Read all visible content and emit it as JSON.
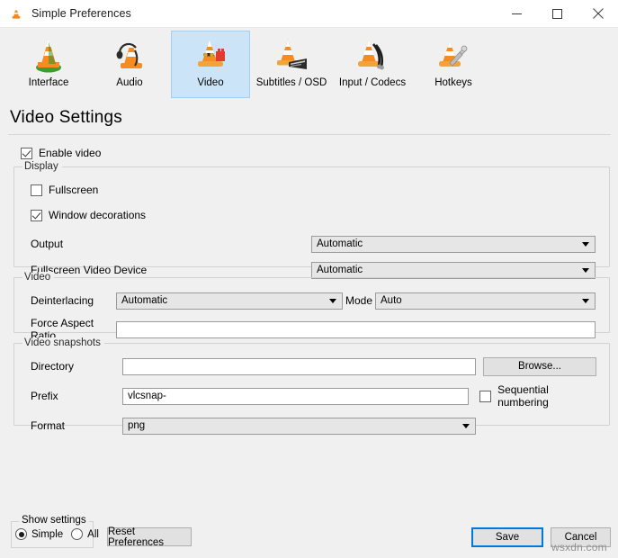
{
  "window": {
    "title": "Simple Preferences",
    "icon": "vlc-cone-icon",
    "minimize_label": "–",
    "maximize_label": "□",
    "close_label": "✕"
  },
  "toolbar": {
    "items": [
      {
        "label": "Interface",
        "icon": "vlc-cone-interface-icon",
        "selected": false
      },
      {
        "label": "Audio",
        "icon": "vlc-cone-headphones-icon",
        "selected": false
      },
      {
        "label": "Video",
        "icon": "vlc-cone-video-icon",
        "selected": true
      },
      {
        "label": "Subtitles / OSD",
        "icon": "vlc-cone-subtitles-icon",
        "selected": false
      },
      {
        "label": "Input / Codecs",
        "icon": "vlc-cone-input-icon",
        "selected": false
      },
      {
        "label": "Hotkeys",
        "icon": "vlc-cone-hotkeys-icon",
        "selected": false
      }
    ]
  },
  "page": {
    "heading": "Video Settings",
    "enable_video": {
      "label": "Enable video",
      "checked": true
    }
  },
  "display": {
    "title": "Display",
    "fullscreen": {
      "label": "Fullscreen",
      "checked": false
    },
    "window_decorations": {
      "label": "Window decorations",
      "checked": true
    },
    "output": {
      "label": "Output",
      "value": "Automatic"
    },
    "fullscreen_video_device": {
      "label": "Fullscreen Video Device",
      "value": "Automatic"
    }
  },
  "video": {
    "title": "Video",
    "deinterlacing": {
      "label": "Deinterlacing",
      "value": "Automatic"
    },
    "mode": {
      "label": "Mode",
      "value": "Auto"
    },
    "force_aspect_ratio": {
      "label": "Force Aspect Ratio",
      "value": ""
    }
  },
  "snapshots": {
    "title": "Video snapshots",
    "directory": {
      "label": "Directory",
      "value": ""
    },
    "browse_label": "Browse...",
    "prefix": {
      "label": "Prefix",
      "value": "vlcsnap-"
    },
    "sequential_numbering": {
      "label": "Sequential numbering",
      "checked": false
    },
    "format": {
      "label": "Format",
      "value": "png"
    }
  },
  "footer": {
    "show_settings_title": "Show settings",
    "simple_label": "Simple",
    "all_label": "All",
    "simple_selected": true,
    "all_selected": false,
    "reset_label": "Reset Preferences",
    "save_label": "Save",
    "cancel_label": "Cancel"
  },
  "watermark": {
    "text": "wsxdn.com"
  },
  "colors": {
    "window_background": "#f0f0f0",
    "titlebar_background": "#ffffff",
    "selected_tab": "#cce4f7",
    "selected_tab_border": "#a6cdea",
    "default_button_border": "#0078d7",
    "combo_background": "#e6e6e6",
    "input_background": "#ffffff",
    "group_border": "#d2d2d2"
  }
}
